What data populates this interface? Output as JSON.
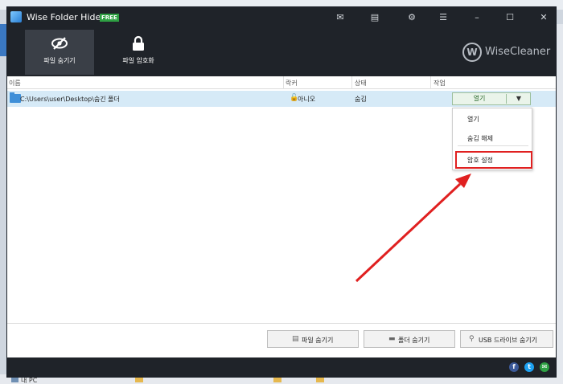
{
  "app": {
    "title": "Wise Folder Hider",
    "badge": "FREE"
  },
  "toolbar": {
    "tabs": [
      {
        "label": "파일 숨기기",
        "icon": "eye-slash-icon"
      },
      {
        "label": "파일 암호화",
        "icon": "lock-icon"
      }
    ],
    "brand": "WiseCleaner"
  },
  "list": {
    "headers": {
      "name": "이름",
      "lock": "락커",
      "status": "상태",
      "action": "작업"
    },
    "rows": [
      {
        "path": "C:\\Users\\user\\Desktop\\숨긴 폴더",
        "lock": "아니오",
        "status": "숨김",
        "action": "열기",
        "dropdown": "▼"
      }
    ]
  },
  "dropdown": {
    "items": [
      "열기",
      "숨김 해제",
      "암호 설정"
    ]
  },
  "buttons": {
    "hide_file": "파일 숨기기",
    "hide_folder": "폴더 숨기기",
    "hide_usb": "USB 드라이브 숨기기"
  },
  "desktop": {
    "taskbar_label": "내 PC"
  },
  "colors": {
    "dark": "#1f2329",
    "accent": "#e02020",
    "row_select": "#d6eaf7",
    "free": "#2ea043"
  }
}
